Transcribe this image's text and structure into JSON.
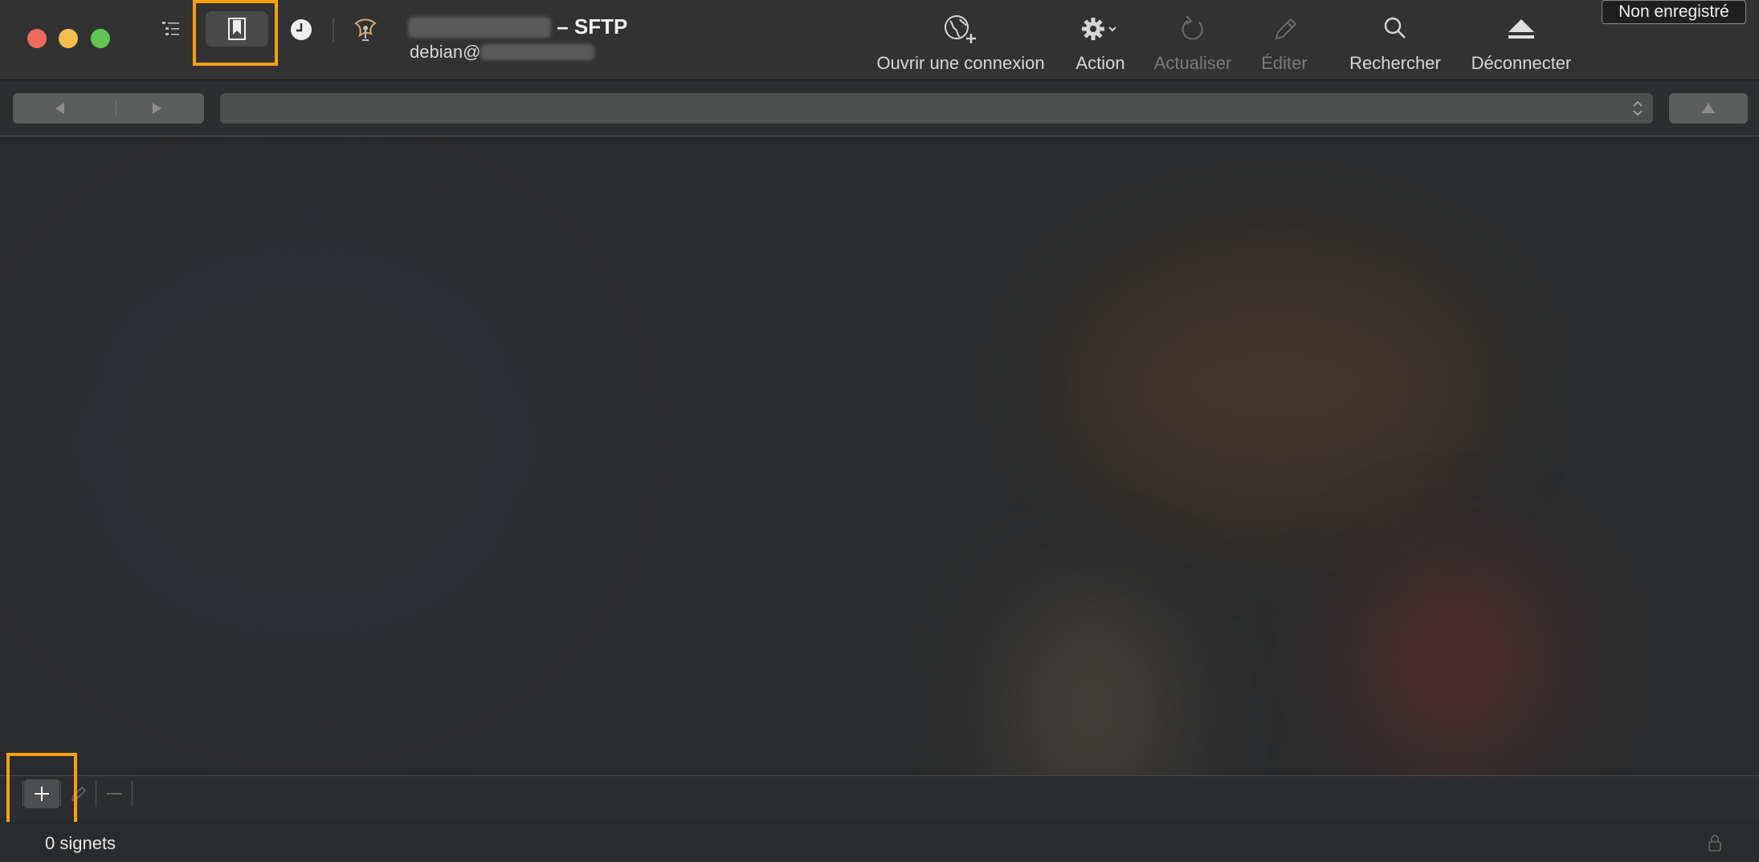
{
  "window": {
    "title_suffix": "– SFTP",
    "subtitle_prefix": "debian@"
  },
  "toolbar": {
    "left_icons": [
      "outline-view-icon",
      "bookmark-icon",
      "history-clock-icon",
      "bonjour-network-icon"
    ],
    "items": [
      {
        "id": "open",
        "label": "Ouvrir une connexion",
        "icon": "globe-plus-icon",
        "enabled": true
      },
      {
        "id": "action",
        "label": "Action",
        "icon": "gear-icon",
        "enabled": true
      },
      {
        "id": "refresh",
        "label": "Actualiser",
        "icon": "refresh-icon",
        "enabled": false
      },
      {
        "id": "edit",
        "label": "Éditer",
        "icon": "pencil-icon",
        "enabled": false
      },
      {
        "id": "search",
        "label": "Rechercher",
        "icon": "search-icon",
        "enabled": true
      },
      {
        "id": "disconnect",
        "label": "Déconnecter",
        "icon": "eject-icon",
        "enabled": true
      }
    ]
  },
  "badge": {
    "label": "Non enregistré"
  },
  "status": {
    "text": "0 signets"
  },
  "colors": {
    "highlight": "#f5a012",
    "close": "#ed6a5e",
    "minimize": "#f5bf4f",
    "zoom": "#61c554"
  }
}
